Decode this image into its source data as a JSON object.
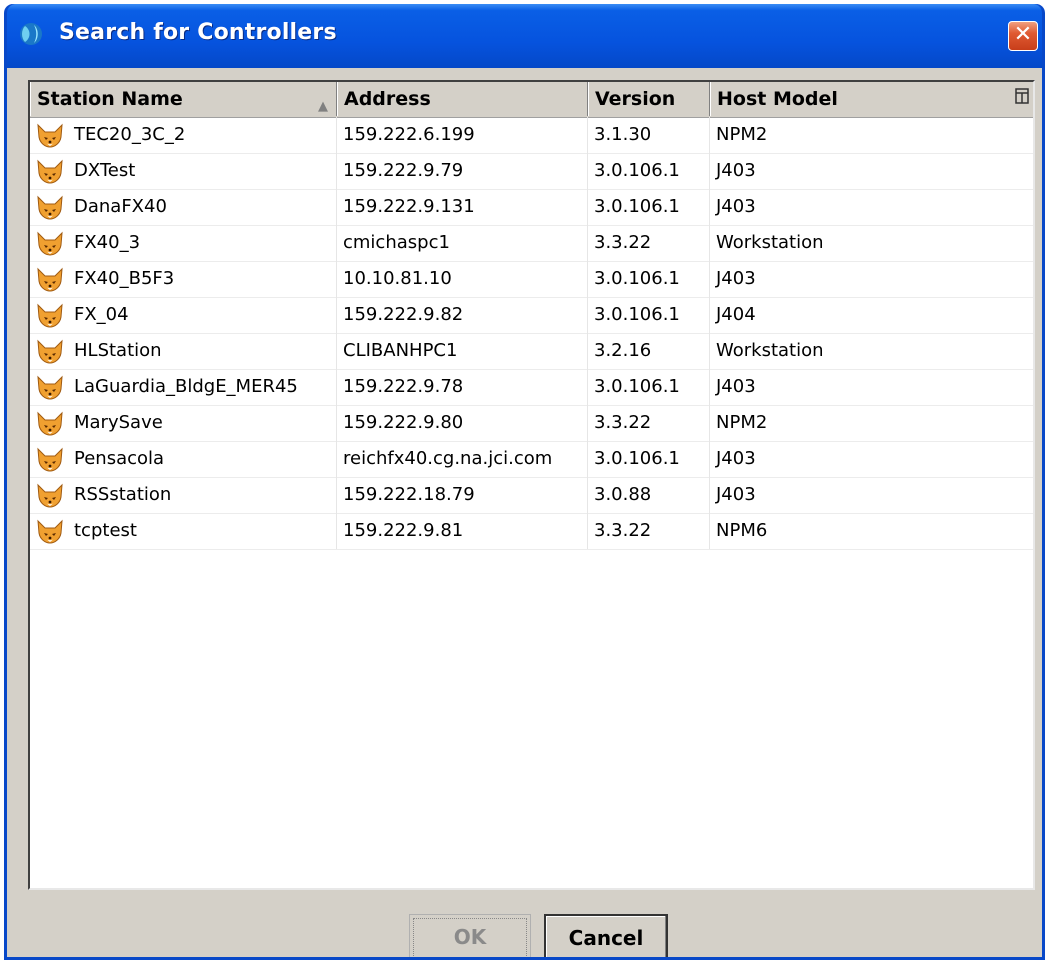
{
  "window": {
    "title": "Search for Controllers",
    "close_label": "✕"
  },
  "table": {
    "columns": [
      "Station Name",
      "Address",
      "Version",
      "Host Model"
    ],
    "sorted_column": "Station Name",
    "sort_direction": "ascending",
    "rows": [
      {
        "name": "TEC20_3C_2",
        "address": "159.222.6.199",
        "version": "3.1.30",
        "host": "NPM2"
      },
      {
        "name": "DXTest",
        "address": "159.222.9.79",
        "version": "3.0.106.1",
        "host": "J403"
      },
      {
        "name": "DanaFX40",
        "address": "159.222.9.131",
        "version": "3.0.106.1",
        "host": "J403"
      },
      {
        "name": "FX40_3",
        "address": "cmichaspc1",
        "version": "3.3.22",
        "host": "Workstation"
      },
      {
        "name": "FX40_B5F3",
        "address": "10.10.81.10",
        "version": "3.0.106.1",
        "host": "J403"
      },
      {
        "name": "FX_04",
        "address": "159.222.9.82",
        "version": "3.0.106.1",
        "host": "J404"
      },
      {
        "name": "HLStation",
        "address": "CLIBANHPC1",
        "version": "3.2.16",
        "host": "Workstation"
      },
      {
        "name": "LaGuardia_BldgE_MER45",
        "address": "159.222.9.78",
        "version": "3.0.106.1",
        "host": "J403"
      },
      {
        "name": "MarySave",
        "address": "159.222.9.80",
        "version": "3.3.22",
        "host": "NPM2"
      },
      {
        "name": "Pensacola",
        "address": "reichfx40.cg.na.jci.com",
        "version": "3.0.106.1",
        "host": "J403"
      },
      {
        "name": "RSSstation",
        "address": "159.222.18.79",
        "version": "3.0.88",
        "host": "J403"
      },
      {
        "name": "tcptest",
        "address": "159.222.9.81",
        "version": "3.3.22",
        "host": "NPM6"
      }
    ]
  },
  "buttons": {
    "ok_label": "OK",
    "ok_enabled": false,
    "cancel_label": "Cancel"
  },
  "icons": {
    "title": "niagara-globe-icon",
    "row": "station-fox-icon",
    "column_chooser": "column-chooser-icon",
    "sort": "sort-ascending-icon"
  },
  "colors": {
    "titlebar": "#0653de",
    "close_button": "#e05a32",
    "dialog_bg": "#d4d0c8",
    "fox_orange": "#f0a030"
  }
}
